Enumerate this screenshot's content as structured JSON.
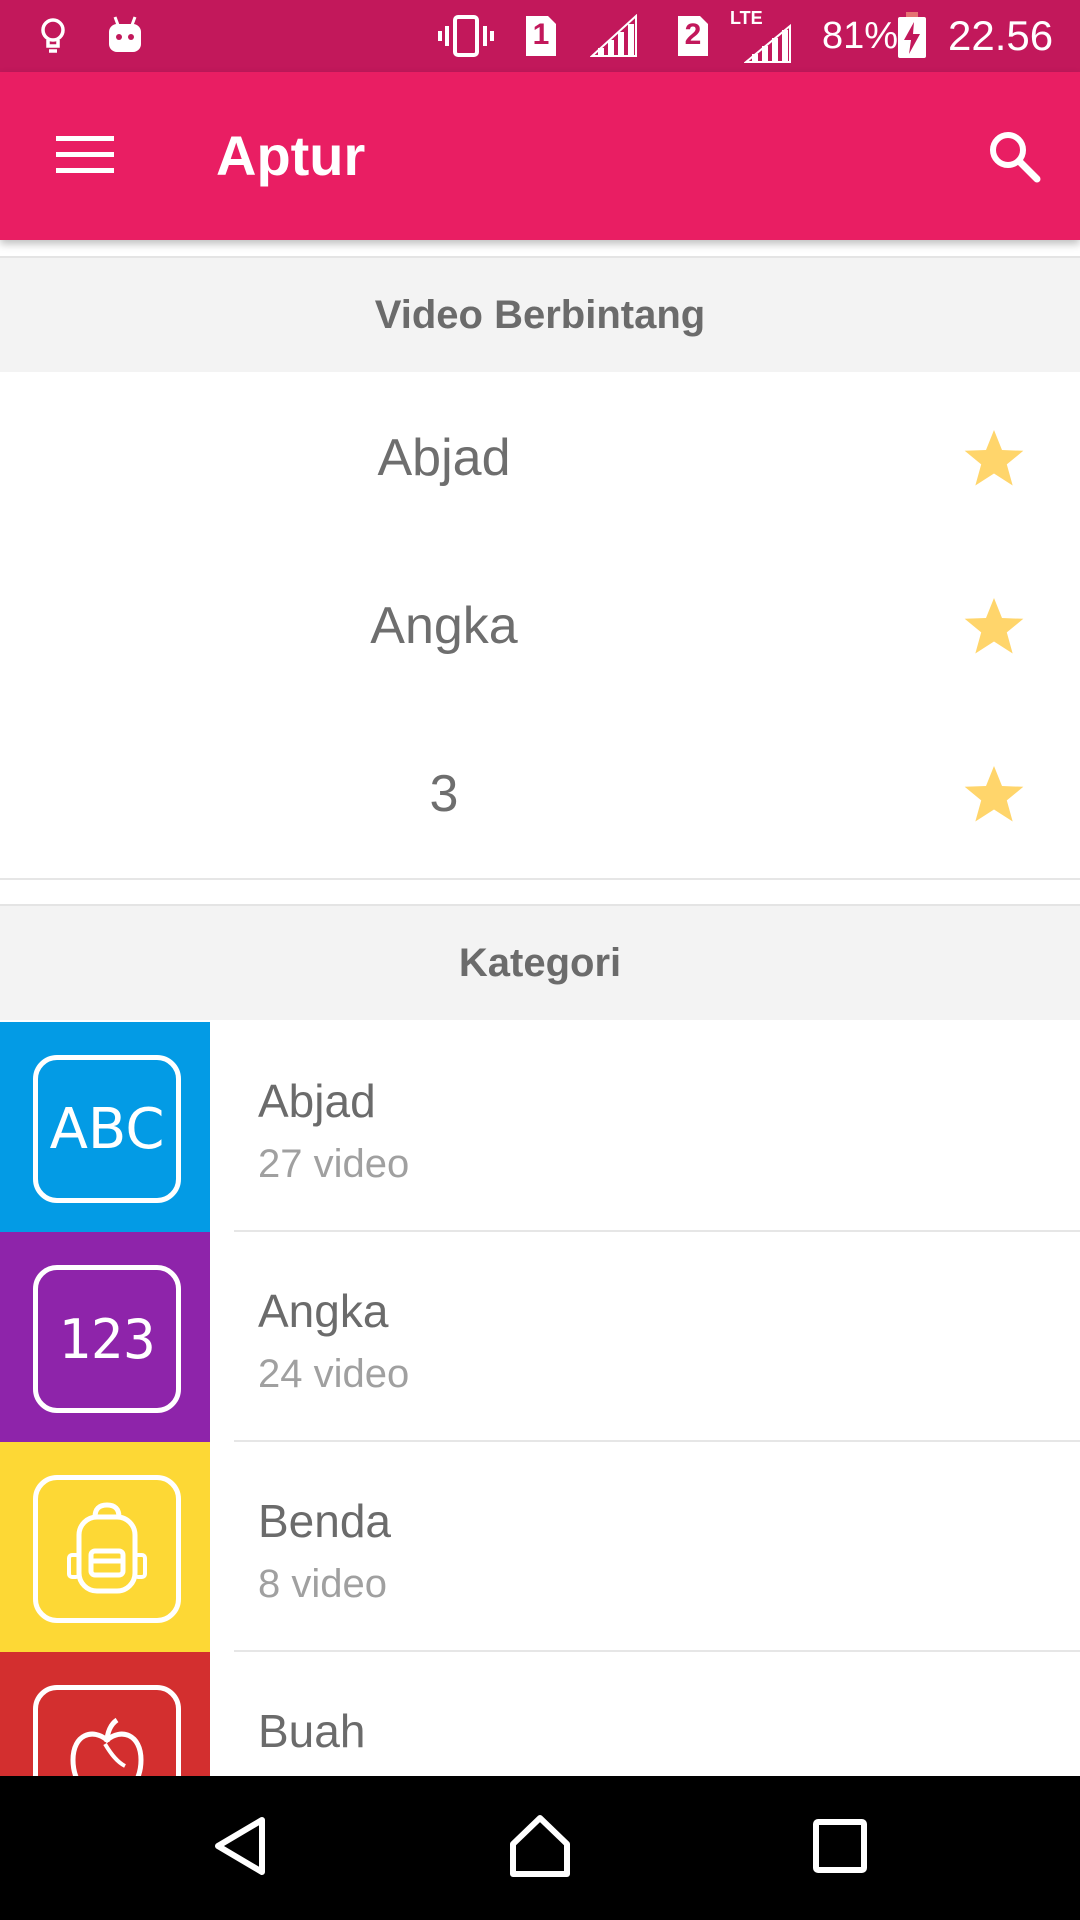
{
  "status_bar": {
    "sim1": "1",
    "sim2": "2",
    "network": "LTE",
    "battery": "81%",
    "time": "22.56"
  },
  "app_bar": {
    "title": "Aptur"
  },
  "starred": {
    "header": "Video Berbintang",
    "items": [
      {
        "label": "Abjad"
      },
      {
        "label": "Angka"
      },
      {
        "label": "3"
      }
    ],
    "star_color": "#ffd56b"
  },
  "categories": {
    "header": "Kategori",
    "items": [
      {
        "name": "Abjad",
        "count": "27 video",
        "icon": "abc-icon",
        "icon_text": "ABC",
        "color": "#039be5"
      },
      {
        "name": "Angka",
        "count": "24 video",
        "icon": "numbers-icon",
        "icon_text": "123",
        "color": "#8e24aa"
      },
      {
        "name": "Benda",
        "count": "8 video",
        "icon": "backpack-icon",
        "color": "#fdd835"
      },
      {
        "name": "Buah",
        "count": "",
        "icon": "apple-icon",
        "color": "#d32f2f"
      }
    ]
  },
  "colors": {
    "status_bar": "#c2185b",
    "app_bar": "#e91e63"
  }
}
